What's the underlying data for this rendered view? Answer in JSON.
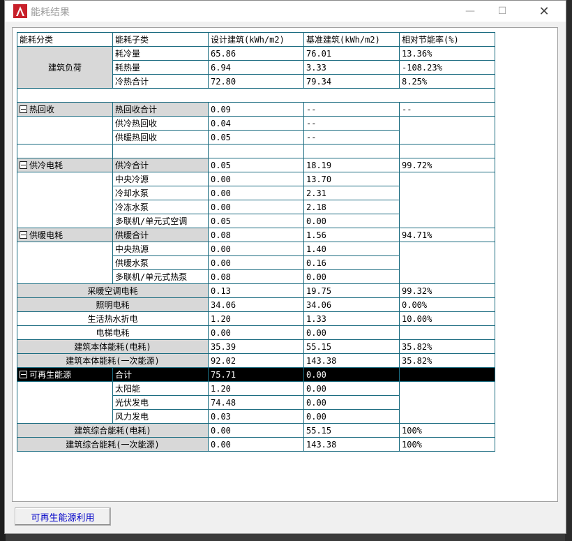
{
  "window": {
    "title": "能耗结果",
    "minimize": "—",
    "maximize": "☐",
    "close": "✕"
  },
  "table": {
    "headers": [
      "能耗分类",
      "能耗子类",
      "设计建筑(kWh/m2)",
      "基准建筑(kWh/m2)",
      "相对节能率(%)"
    ],
    "load": {
      "category": "建筑负荷",
      "rows": [
        [
          "耗冷量",
          "65.86",
          "76.01",
          "13.36%"
        ],
        [
          "耗热量",
          "6.94",
          "3.33",
          "-108.23%"
        ],
        [
          "冷热合计",
          "72.80",
          "79.34",
          "8.25%"
        ]
      ]
    },
    "heat_recovery": {
      "category": "热回收",
      "rows": [
        [
          "热回收合计",
          "0.09",
          "--",
          "--"
        ],
        [
          "供冷热回收",
          "0.04",
          "--"
        ],
        [
          "供暖热回收",
          "0.05",
          "--"
        ]
      ]
    },
    "cooling": {
      "category": "供冷电耗",
      "rows": [
        [
          "供冷合计",
          "0.05",
          "18.19",
          "99.72%"
        ],
        [
          "中央冷源",
          "0.00",
          "13.70"
        ],
        [
          "冷却水泵",
          "0.00",
          "2.31"
        ],
        [
          "冷冻水泵",
          "0.00",
          "2.18"
        ],
        [
          "多联机/单元式空调",
          "0.05",
          "0.00"
        ]
      ]
    },
    "heating": {
      "category": "供暖电耗",
      "rows": [
        [
          "供暖合计",
          "0.08",
          "1.56",
          "94.71%"
        ],
        [
          "中央热源",
          "0.00",
          "1.40"
        ],
        [
          "供暖水泵",
          "0.00",
          "0.16"
        ],
        [
          "多联机/单元式热泵",
          "0.08",
          "0.00"
        ]
      ]
    },
    "summary1": [
      [
        "采暖空调电耗",
        "0.13",
        "19.75",
        "99.32%"
      ],
      [
        "照明电耗",
        "34.06",
        "34.06",
        "0.00%"
      ],
      [
        "生活热水折电",
        "1.20",
        "1.33",
        "10.00%"
      ],
      [
        "电梯电耗",
        "0.00",
        "0.00",
        ""
      ],
      [
        "建筑本体能耗(电耗)",
        "35.39",
        "55.15",
        "35.82%"
      ],
      [
        "建筑本体能耗(一次能源)",
        "92.02",
        "143.38",
        "35.82%"
      ]
    ],
    "renewable": {
      "category": "可再生能源",
      "rows": [
        [
          "合计",
          "75.71",
          "0.00",
          ""
        ],
        [
          "太阳能",
          "1.20",
          "0.00"
        ],
        [
          "光伏发电",
          "74.48",
          "0.00"
        ],
        [
          "风力发电",
          "0.03",
          "0.00"
        ]
      ]
    },
    "summary2": [
      [
        "建筑综合能耗(电耗)",
        "0.00",
        "55.15",
        "100%"
      ],
      [
        "建筑综合能耗(一次能源)",
        "0.00",
        "143.38",
        "100%"
      ]
    ]
  },
  "buttons": {
    "renewable_use": "可再生能源利用"
  }
}
